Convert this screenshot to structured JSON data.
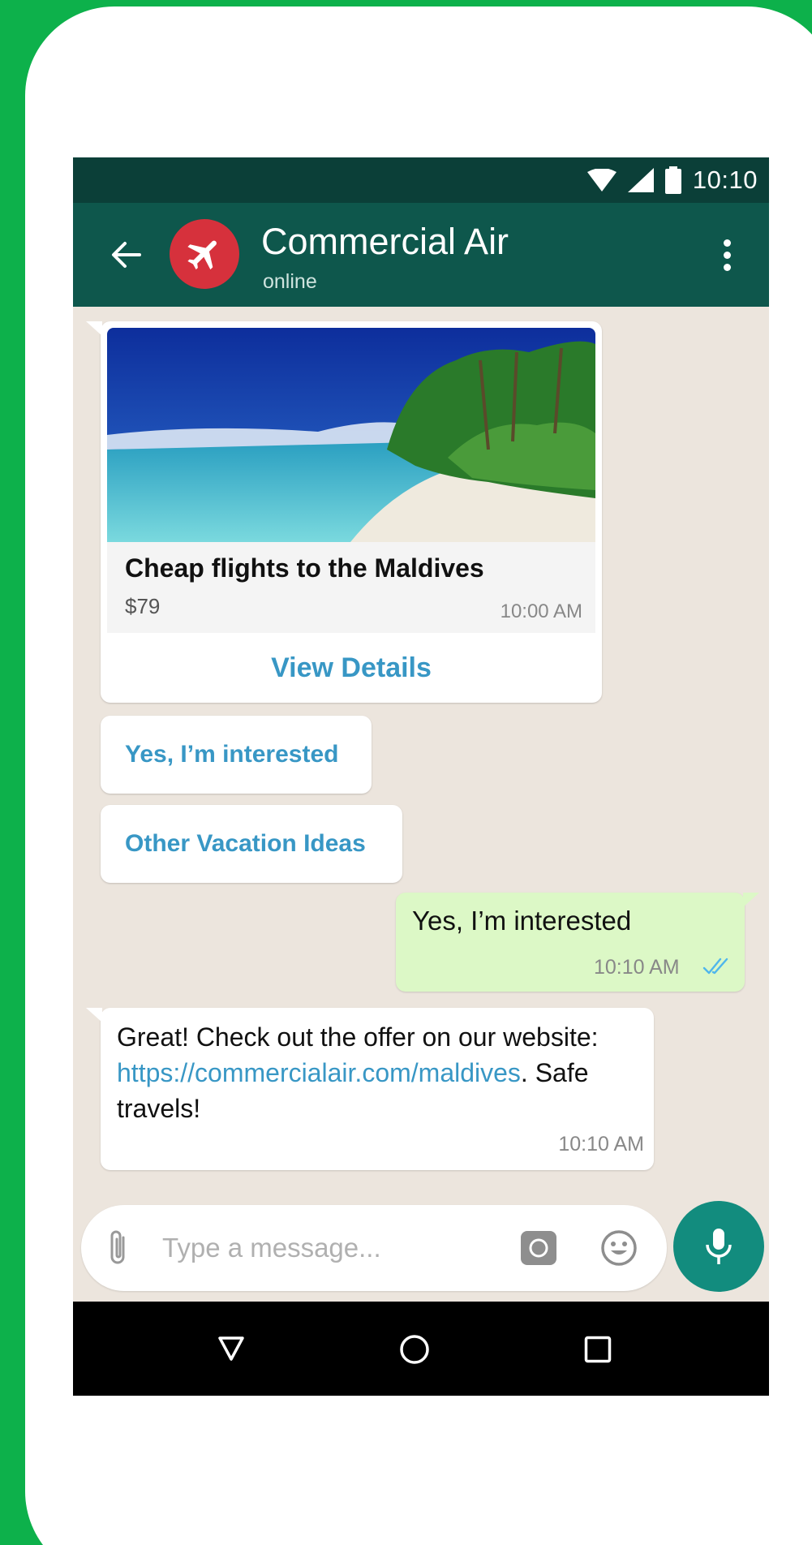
{
  "status_bar": {
    "time": "10:10"
  },
  "app_bar": {
    "contact_name": "Commercial Air",
    "contact_status": "online",
    "avatar_color": "#d6313c",
    "header_color": "#0e574c"
  },
  "messages": {
    "offer_card": {
      "title": "Cheap flights to the Maldives",
      "price": "$79",
      "time": "10:00 AM",
      "action_label": "View Details"
    },
    "quick_replies": [
      {
        "label": "Yes, I’m interested"
      },
      {
        "label": "Other Vacation Ideas"
      }
    ],
    "outgoing": {
      "text": "Yes, I’m interested",
      "time": "10:10 AM",
      "status": "read"
    },
    "incoming": {
      "text_before": "Great! Check out the offer on our website: ",
      "link": "https://commercialair.com/maldives",
      "text_after": ". Safe travels!",
      "time": "10:10 AM"
    }
  },
  "composer": {
    "placeholder": "Type a message...",
    "value": ""
  },
  "icons": {
    "back": "arrow-left-icon",
    "menu": "more-vert-icon",
    "attach": "paperclip-icon",
    "camera": "camera-icon",
    "emoji": "smiley-icon",
    "mic": "microphone-icon"
  },
  "colors": {
    "accent": "#128c7e",
    "link": "#3897c5",
    "outgoing_bubble": "#dcf8c6",
    "chat_background": "#ece5dd"
  }
}
